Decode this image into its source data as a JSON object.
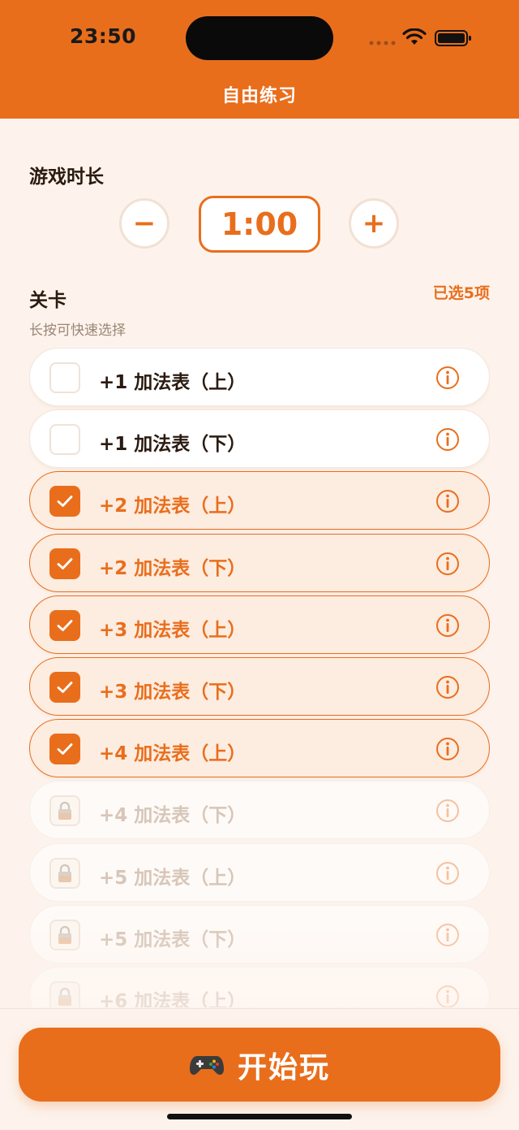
{
  "status_bar": {
    "time": "23:50"
  },
  "header": {
    "title": "自由练习"
  },
  "duration": {
    "title": "游戏时长",
    "value": "1:00",
    "minus_label": "−",
    "plus_label": "+"
  },
  "levels": {
    "title": "关卡",
    "selected_count": "已选5项",
    "hint": "长按可快速选择",
    "items": [
      {
        "label": "+1 加法表（上）",
        "state": "unselected"
      },
      {
        "label": "+1 加法表（下）",
        "state": "unselected"
      },
      {
        "label": "+2 加法表（上）",
        "state": "selected"
      },
      {
        "label": "+2 加法表（下）",
        "state": "selected"
      },
      {
        "label": "+3 加法表（上）",
        "state": "selected"
      },
      {
        "label": "+3 加法表（下）",
        "state": "selected"
      },
      {
        "label": "+4 加法表（上）",
        "state": "selected"
      },
      {
        "label": "+4 加法表（下）",
        "state": "locked"
      },
      {
        "label": "+5 加法表（上）",
        "state": "locked"
      },
      {
        "label": "+5 加法表（下）",
        "state": "locked"
      },
      {
        "label": "+6 加法表（上）",
        "state": "locked"
      }
    ]
  },
  "start_button": {
    "label": "开始玩",
    "icon": "gamepad-icon"
  },
  "colors": {
    "accent": "#e96e1c",
    "background": "#fdf3ec",
    "selected_bg": "#fdece0"
  }
}
